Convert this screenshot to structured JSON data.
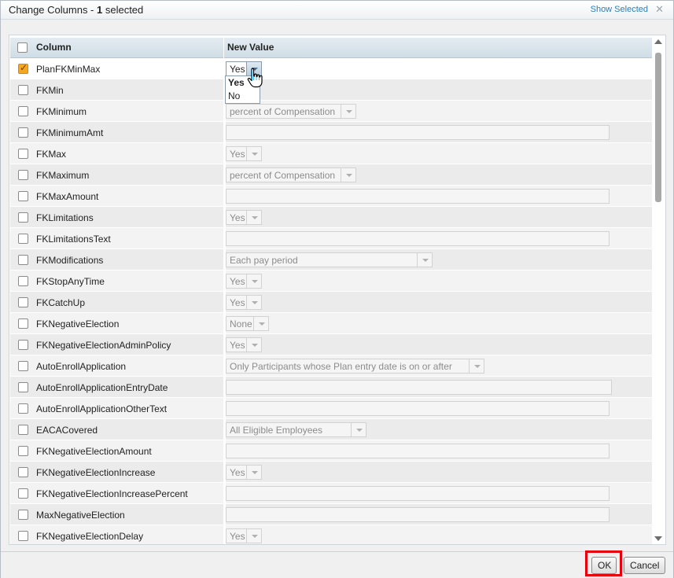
{
  "dialog": {
    "title_prefix": "Change Columns - ",
    "selected_count": "1",
    "title_suffix": " selected",
    "show_selected": "Show Selected",
    "close": "✕"
  },
  "table": {
    "headers": {
      "column": "Column",
      "new_value": "New Value"
    }
  },
  "rows": [
    {
      "name": "PlanFKMinMax",
      "checked": true,
      "type": "select",
      "value": "Yes",
      "active": true
    },
    {
      "name": "FKMin",
      "checked": false,
      "type": "none",
      "value": ""
    },
    {
      "name": "FKMinimum",
      "checked": false,
      "type": "select",
      "value": "percent of Compensation"
    },
    {
      "name": "FKMinimumAmt",
      "checked": false,
      "type": "text",
      "value": ""
    },
    {
      "name": "FKMax",
      "checked": false,
      "type": "select",
      "value": "Yes"
    },
    {
      "name": "FKMaximum",
      "checked": false,
      "type": "select",
      "value": "percent of Compensation"
    },
    {
      "name": "FKMaxAmount",
      "checked": false,
      "type": "text",
      "value": ""
    },
    {
      "name": "FKLimitations",
      "checked": false,
      "type": "select",
      "value": "Yes"
    },
    {
      "name": "FKLimitationsText",
      "checked": false,
      "type": "text",
      "value": ""
    },
    {
      "name": "FKModifications",
      "checked": false,
      "type": "select",
      "value": "Each pay period"
    },
    {
      "name": "FKStopAnyTime",
      "checked": false,
      "type": "select",
      "value": "Yes"
    },
    {
      "name": "FKCatchUp",
      "checked": false,
      "type": "select",
      "value": "Yes"
    },
    {
      "name": "FKNegativeElection",
      "checked": false,
      "type": "select",
      "value": "None"
    },
    {
      "name": "FKNegativeElectionAdminPolicy",
      "checked": false,
      "type": "select",
      "value": "Yes"
    },
    {
      "name": "AutoEnrollApplication",
      "checked": false,
      "type": "select",
      "value": "Only Participants whose Plan entry date is on or after"
    },
    {
      "name": "AutoEnrollApplicationEntryDate",
      "checked": false,
      "type": "text",
      "value": ""
    },
    {
      "name": "AutoEnrollApplicationOtherText",
      "checked": false,
      "type": "text",
      "value": ""
    },
    {
      "name": "EACACovered",
      "checked": false,
      "type": "select",
      "value": "All Eligible Employees"
    },
    {
      "name": "FKNegativeElectionAmount",
      "checked": false,
      "type": "text",
      "value": ""
    },
    {
      "name": "FKNegativeElectionIncrease",
      "checked": false,
      "type": "select",
      "value": "Yes"
    },
    {
      "name": "FKNegativeElectionIncreasePercent",
      "checked": false,
      "type": "text",
      "value": ""
    },
    {
      "name": "MaxNegativeElection",
      "checked": false,
      "type": "text",
      "value": ""
    },
    {
      "name": "FKNegativeElectionDelay",
      "checked": false,
      "type": "select",
      "value": "Yes"
    }
  ],
  "dropdown_options": [
    "Yes",
    "No"
  ],
  "buttons": {
    "ok": "OK",
    "cancel": "Cancel"
  }
}
